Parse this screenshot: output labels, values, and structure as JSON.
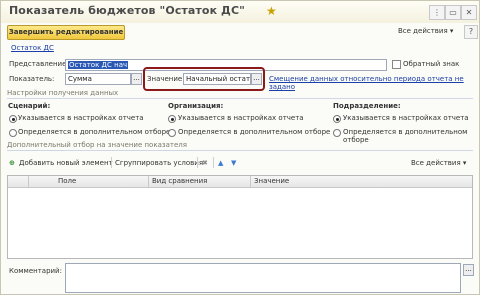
{
  "window": {
    "title": "Показатель бюджетов \"Остаток ДС\"",
    "controls": [
      "⋮",
      "▭",
      "✕"
    ]
  },
  "toolbar": {
    "finish_label": "Завершить редактирование",
    "all_actions": "Все действия ▾",
    "help": "?"
  },
  "link_top": "Остаток ДС",
  "fields": {
    "representation_label": "Представление:",
    "representation_value": "Остаток ДС нач",
    "reverse_sign_label": "Обратный знак",
    "indicator_label": "Показатель:",
    "indicator_value": "Сумма",
    "value_label": "Значение:",
    "value_value": "Начальный остаток",
    "offset_link": "Смещение данных относительно периода отчета не задано",
    "dots": "..."
  },
  "section_receive": "Настройки получения данных",
  "columns": [
    {
      "header": "Сценарий:",
      "opt1": "Указывается в настройках отчета",
      "opt2": "Определяется в дополнительном отборе"
    },
    {
      "header": "Организация:",
      "opt1": "Указывается в настройках отчета",
      "opt2": "Определяется в дополнительном отборе"
    },
    {
      "header": "Подразделение:",
      "opt1": "Указывается в настройках отчета",
      "opt2": "Определяется в дополнительном отборе"
    }
  ],
  "section_filter": "Дополнительный отбор на значение показателя",
  "filter_toolbar": {
    "add_label": "Добавить новый элемент",
    "group_label": "Сгруппировать условия",
    "delete_icon": "✖",
    "up_icon": "▲",
    "down_icon": "▼",
    "all_actions": "Все действия ▾"
  },
  "table": {
    "headers": [
      "Поле",
      "Вид сравнения",
      "Значение"
    ]
  },
  "comment_label": "Комментарий:"
}
